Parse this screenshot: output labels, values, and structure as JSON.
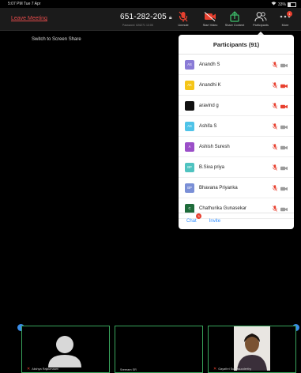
{
  "status_bar": {
    "time": "5:07 PM  Tue 7 Apr",
    "battery": "33%"
  },
  "header": {
    "leave_label": "Leave Meeting",
    "meeting_id": "651-282-205",
    "password_text": "Password: 626271   13:05"
  },
  "toolbar": {
    "unmute_label": "Unmute",
    "start_video_label": "Start Video",
    "share_content_label": "Share Content",
    "participants_label": "Participants",
    "more_label": "More",
    "more_badge": "1"
  },
  "main": {
    "switch_share_label": "Switch to Screen Share"
  },
  "participants_panel": {
    "title": "Participants (91)",
    "items": [
      {
        "initials": "AS",
        "name": "Anandh S",
        "avatar_color": "#8a7bd6",
        "video_off_red": false
      },
      {
        "initials": "AK",
        "name": "Anandhi K",
        "avatar_color": "#f5c518",
        "video_off_red": true
      },
      {
        "initials": "",
        "name": "aravind g",
        "avatar_color": "#111111",
        "video_off_red": true
      },
      {
        "initials": "AS",
        "name": "Ashifa S",
        "avatar_color": "#4fc3e8",
        "video_off_red": false
      },
      {
        "initials": "A",
        "name": "Ashish Suresh",
        "avatar_color": "#9b4fc8",
        "video_off_red": false
      },
      {
        "initials": "BP",
        "name": "B.Siva priya",
        "avatar_color": "#4fc3c0",
        "video_off_red": false
      },
      {
        "initials": "BP",
        "name": "Bhavana Priyanka",
        "avatar_color": "#7a8fd6",
        "video_off_red": false
      },
      {
        "initials": "C",
        "name": "Chathurika Gunasekar",
        "avatar_color": "#1e6b3a",
        "video_off_red": false
      }
    ],
    "footer": {
      "chat_label": "Chat",
      "chat_badge": "3",
      "invite_label": "Invite"
    }
  },
  "video_strip": {
    "tiles": [
      {
        "name": "Akshya Rajkumaam"
      },
      {
        "name": "Sreeram SR"
      },
      {
        "name": "Gayathri Sumasuoderthy"
      }
    ]
  },
  "colors": {
    "accent_blue": "#2d8cff",
    "leave_red": "#e24a4a",
    "mic_red": "#e8402f",
    "tile_green": "#39a45c"
  }
}
